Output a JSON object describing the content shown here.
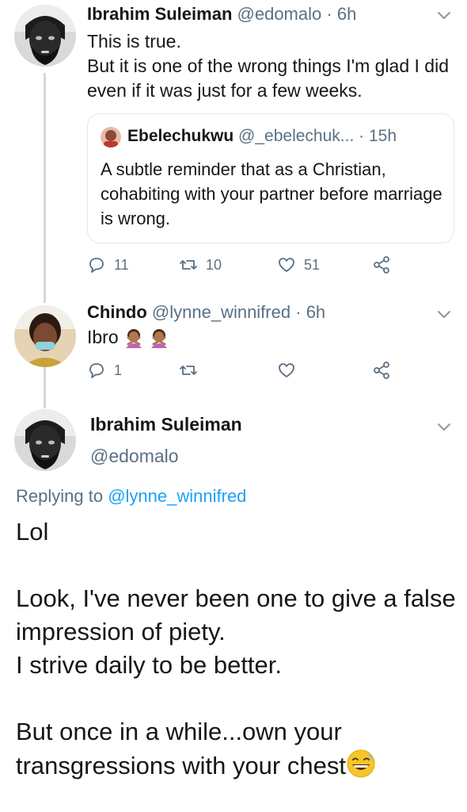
{
  "tweet1": {
    "name": "Ibrahim Suleiman",
    "handle": "@edomalo",
    "time": "6h",
    "text": "This is true.\nBut it is one of the wrong things I'm glad I did even if it was just for a few weeks.",
    "quote": {
      "name": "Ebelechukwu",
      "handle": "@_ebelechuk...",
      "time": "15h",
      "text": "A subtle reminder that as a Christian, cohabiting with your partner before marriage is wrong."
    },
    "replies": "11",
    "retweets": "10",
    "likes": "51"
  },
  "tweet2": {
    "name": "Chindo",
    "handle": "@lynne_winnifred",
    "time": "6h",
    "text": "Ibro",
    "replies": "1"
  },
  "main_tweet": {
    "name": "Ibrahim Suleiman",
    "handle": "@edomalo",
    "replying_prefix": "Replying to",
    "replying_to": "@lynne_winnifred",
    "text": "Lol\n\nLook, I've never been one to give a false impression of piety.\nI strive daily to be better.\n\nBut once in a while...own your transgressions with your chest"
  },
  "separator": "·",
  "icons": {
    "reply": "reply-icon",
    "retweet": "retweet-icon",
    "like": "heart-icon",
    "share": "share-icon",
    "caret": "chevron-down-icon",
    "emoji_person": "person-gesturing-no-emoji",
    "emoji_sweat": "grinning-sweat-emoji"
  },
  "colors": {
    "text": "#14171a",
    "secondary": "#5b7083",
    "link": "#1da1f2",
    "border": "#e1e8ed"
  }
}
